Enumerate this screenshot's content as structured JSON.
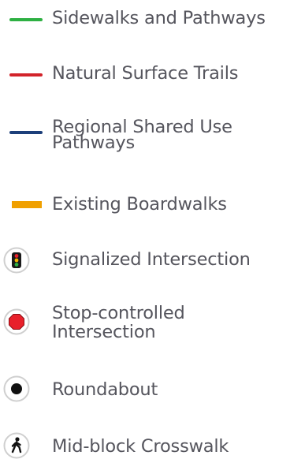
{
  "legend": {
    "items": [
      {
        "label": "Sidewalks and Pathways",
        "symbol": "line",
        "color": "#2eb043"
      },
      {
        "label": "Natural Surface Trails",
        "symbol": "line",
        "color": "#d2232a"
      },
      {
        "label": "Regional Shared Use",
        "label2": "Pathways",
        "symbol": "line",
        "color": "#1d3f7a"
      },
      {
        "label": "Existing Boardwalks",
        "symbol": "bar",
        "color": "#f0a000"
      },
      {
        "label": "Signalized Intersection",
        "symbol": "traffic-light-icon"
      },
      {
        "label": "Stop-controlled",
        "label2": "Intersection",
        "symbol": "stop-sign-icon",
        "color": "#e8202a"
      },
      {
        "label": "Roundabout",
        "symbol": "roundabout-icon"
      },
      {
        "label": "Mid-block Crosswalk",
        "symbol": "pedestrian-icon"
      }
    ]
  }
}
